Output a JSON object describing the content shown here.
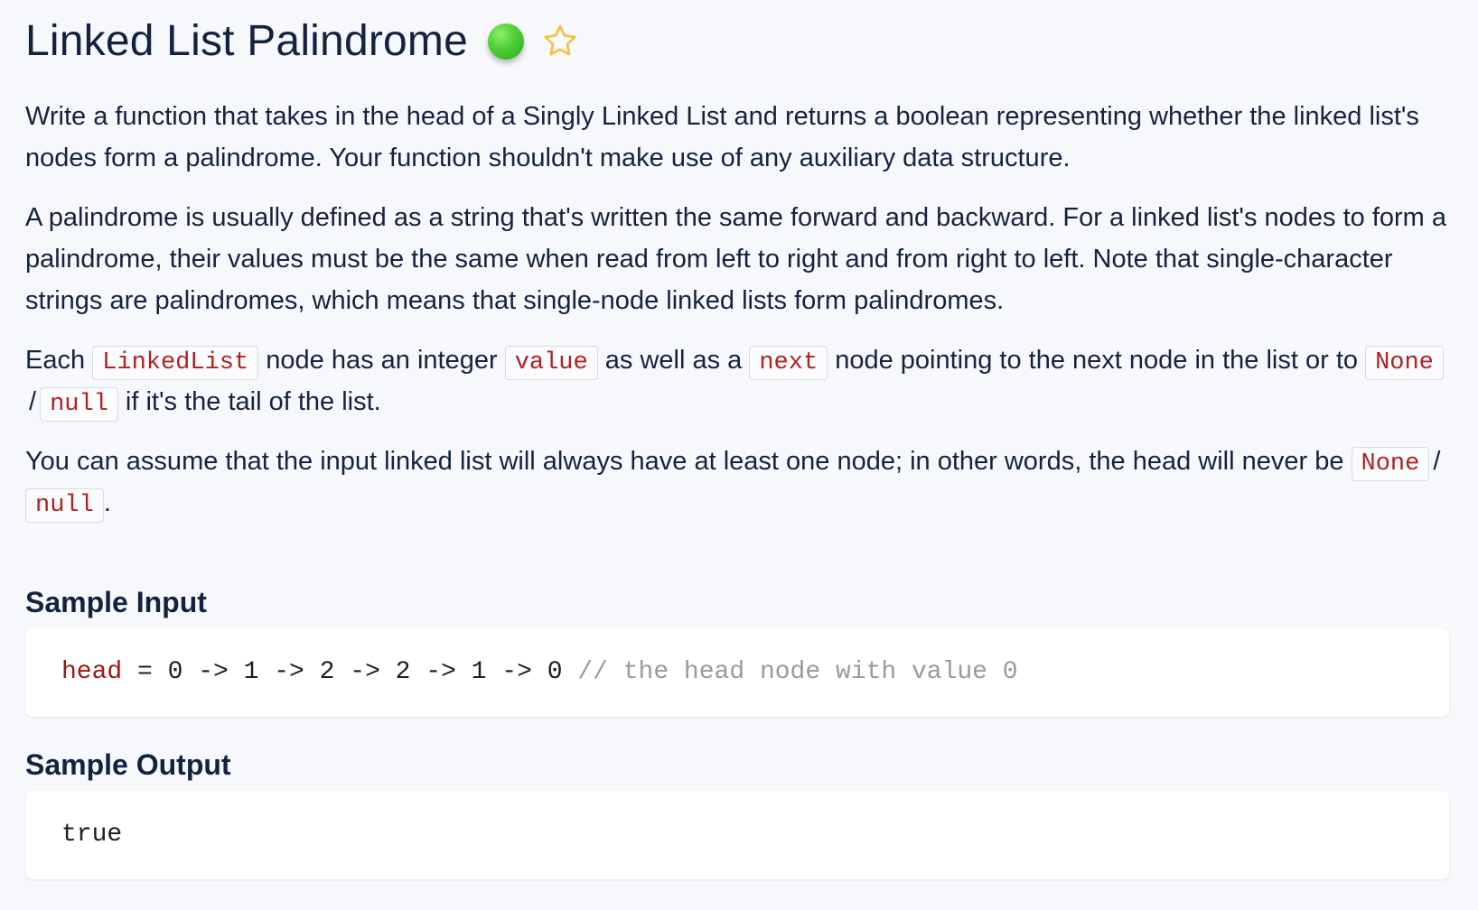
{
  "header": {
    "title": "Linked List Palindrome",
    "difficulty_color": "#4fcf37",
    "star_icon": "star-outline-icon"
  },
  "description": {
    "p1": "Write a function that takes in the head of a Singly Linked List and returns a boolean representing whether the linked list's nodes form a palindrome. Your function shouldn't make use of any auxiliary data structure.",
    "p2": "A palindrome is usually defined as a string that's written the same forward and backward. For a linked list's nodes to form a palindrome, their values must be the same when read from left to right and from right to left. Note that single-character strings are palindromes, which means that single-node linked lists form palindromes.",
    "p3": {
      "text1": "Each ",
      "code1": "LinkedList",
      "text2": " node has an integer ",
      "code2": "value",
      "text3": " as well as a ",
      "code3": "next",
      "text4": " node pointing to the next node in the list or to ",
      "code4": "None",
      "slash": "/",
      "code5": "null",
      "text5": " if it's the tail of the list."
    },
    "p4": {
      "text1": "You can assume that the input linked list will always have at least one node; in other words, the head will never be ",
      "code1": "None",
      "slash": "/",
      "code2": "null",
      "text2": "."
    }
  },
  "sample_input": {
    "title": "Sample Input",
    "variable": "head",
    "expression": " = 0 -> 1 -> 2 -> 2 -> 1 -> 0 ",
    "comment": "// the head node with value 0"
  },
  "sample_output": {
    "title": "Sample Output",
    "value": "true"
  }
}
